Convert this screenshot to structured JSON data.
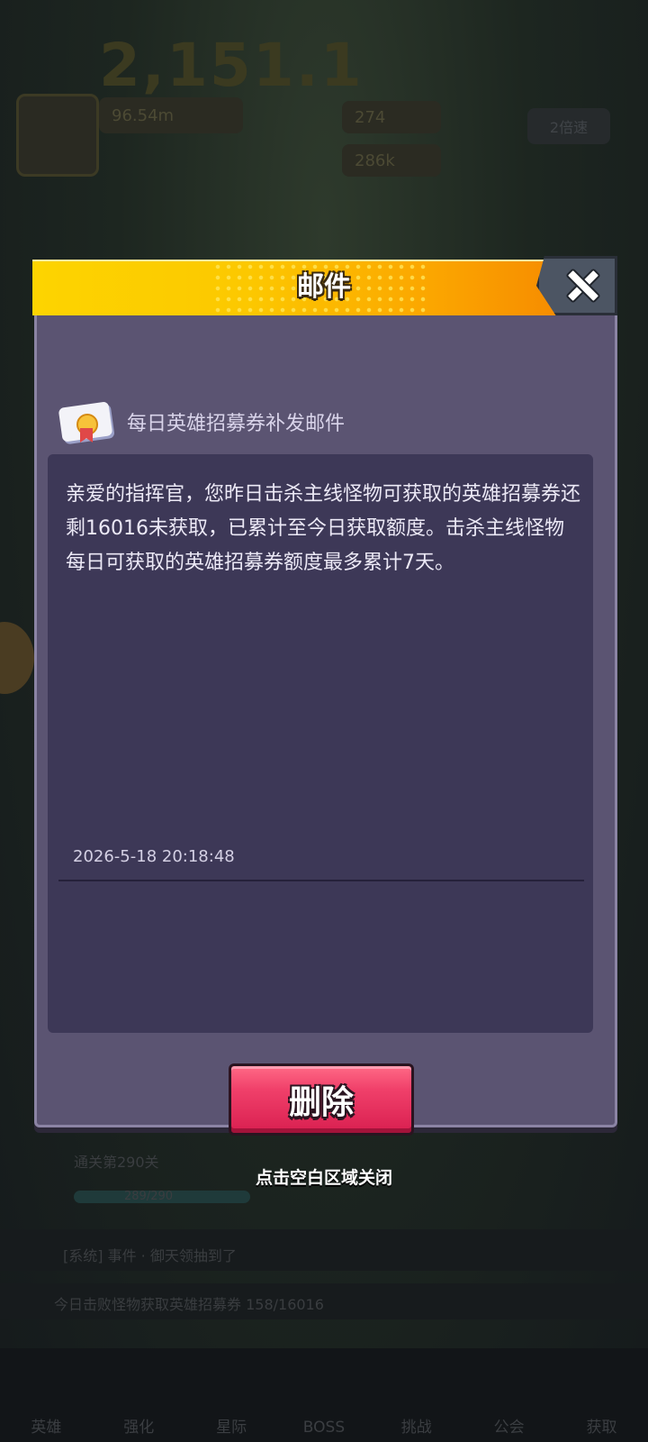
{
  "background": {
    "top_number": "2,151.1",
    "stat_1": "96.54m",
    "stat_2": "274",
    "stat_3": "286k",
    "speed_label": "2倍速",
    "level_label": "通关第290关",
    "level_progress": "289/290",
    "system_chat": "[系统] 事件 · 御天领抽到了",
    "mission_text": "今日击败怪物获取英雄招募券 158/16016",
    "nav_items": [
      "英雄",
      "强化",
      "星际",
      "BOSS",
      "挑战",
      "公会",
      "获取"
    ]
  },
  "dialog": {
    "title": "邮件",
    "mail_title": "每日英雄招募券补发邮件",
    "mail_body": "亲爱的指挥官，您昨日击杀主线怪物可获取的英雄招募券还剩16016未获取，已累计至今日获取额度。击杀主线怪物每日可获取的英雄招募券额度最多累计7天。",
    "timestamp": "2026-5-18 20:18:48",
    "delete_label": "删除"
  },
  "hint": {
    "tap_to_close": "点击空白区域关闭"
  },
  "colors": {
    "header_yellow": "#fdd400",
    "header_orange": "#f68a00",
    "panel": "#5b5472",
    "content": "#3d3857",
    "delete": "#e0285a"
  }
}
